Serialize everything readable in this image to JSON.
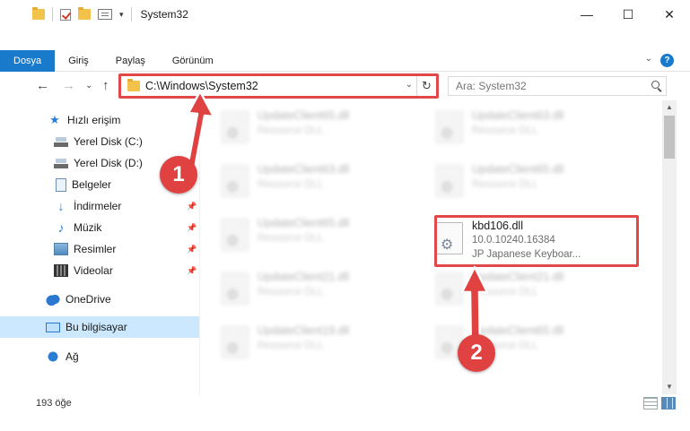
{
  "window": {
    "title": "System32",
    "minimize_label": "—",
    "maximize_label": "☐",
    "close_label": "✕"
  },
  "quick_access_toolbar": {
    "dropdown_label": "▾"
  },
  "ribbon": {
    "tabs": [
      {
        "label": "Dosya"
      },
      {
        "label": "Giriş"
      },
      {
        "label": "Paylaş"
      },
      {
        "label": "Görünüm"
      }
    ],
    "help_label": "?",
    "expand_label": "⌄"
  },
  "navigation": {
    "back_label": "←",
    "forward_label": "→",
    "recent_label": "⌄",
    "up_label": "↑",
    "address": "C:\\Windows\\System32",
    "address_dropdown_label": "⌄",
    "refresh_label": "↻",
    "search_placeholder": "Ara: System32"
  },
  "sidebar": {
    "items": [
      {
        "label": "Hızlı erişim",
        "icon": "star-icon"
      },
      {
        "label": "Yerel Disk (C:)",
        "icon": "disk-icon",
        "pinned": true
      },
      {
        "label": "Yerel Disk (D:)",
        "icon": "disk-icon",
        "pinned": true
      },
      {
        "label": "Belgeler",
        "icon": "document-icon",
        "pinned": true
      },
      {
        "label": "İndirmeler",
        "icon": "download-icon",
        "pinned": true
      },
      {
        "label": "Müzik",
        "icon": "music-icon",
        "pinned": true
      },
      {
        "label": "Resimler",
        "icon": "pictures-icon",
        "pinned": true
      },
      {
        "label": "Videolar",
        "icon": "videos-icon",
        "pinned": true
      },
      {
        "label": "OneDrive",
        "icon": "cloud-icon"
      },
      {
        "label": "Bu bilgisayar",
        "icon": "computer-icon",
        "selected": true
      },
      {
        "label": "Ağ",
        "icon": "network-icon"
      }
    ],
    "pin_glyph": "📌"
  },
  "files": {
    "left_column": [
      {
        "name": "UpdateClient65.dll",
        "description": "Resource DLL"
      },
      {
        "name": "UpdateClient63.dll",
        "description": "Resource DLL"
      },
      {
        "name": "UpdateClient65.dll",
        "description": "Resource DLL"
      },
      {
        "name": "UpdateClient21.dll",
        "description": "Resource DLL"
      },
      {
        "name": "UpdateClient19.dll",
        "description": "Resource DLL"
      }
    ],
    "right_column": [
      {
        "name": "UpdateClient63.dll",
        "description": "Resource DLL"
      },
      {
        "name": "UpdateClient65.dll",
        "description": "Resource DLL"
      },
      {
        "name": "UpdateClient21.dll",
        "description": "Resource DLL"
      },
      {
        "name": "UpdateClient65.dll",
        "description": "Resource DLL"
      }
    ],
    "highlighted": {
      "name": "kbd106.dll",
      "version": "10.0.10240.16384",
      "description": "JP Japanese Keyboar..."
    }
  },
  "annotations": {
    "marker_1": "1",
    "marker_2": "2",
    "highlight_color": "#e24848"
  },
  "status_bar": {
    "item_count": "193 öğe"
  }
}
